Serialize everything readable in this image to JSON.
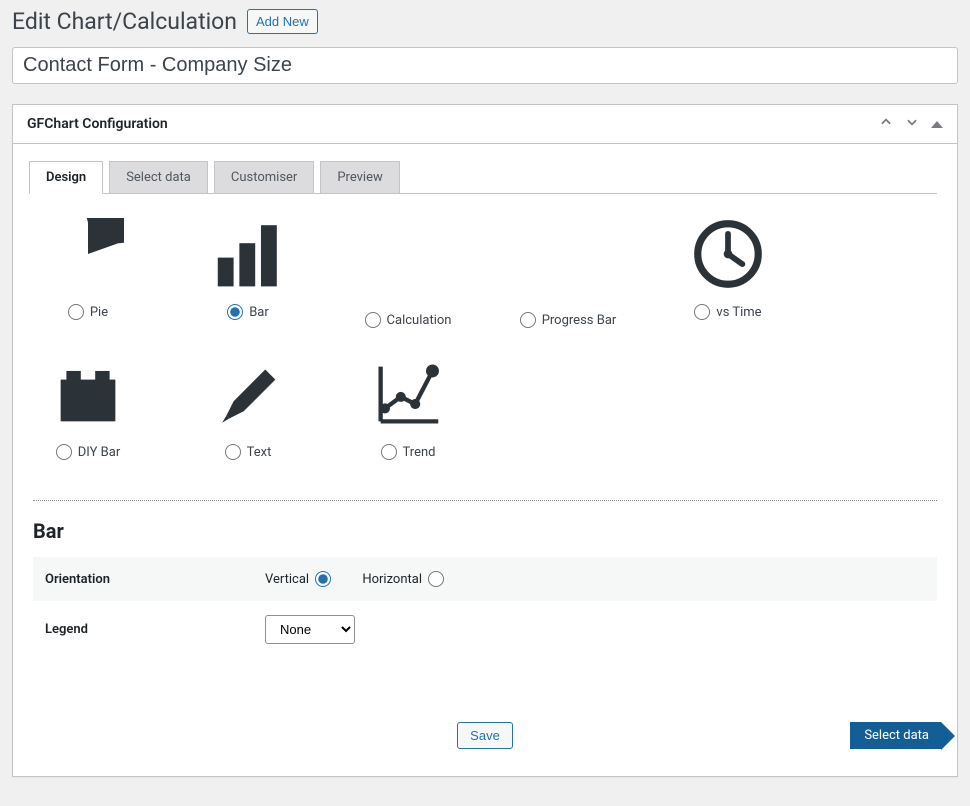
{
  "header": {
    "title": "Edit Chart/Calculation",
    "add_new": "Add New"
  },
  "chart_title": "Contact Form - Company Size",
  "panel": {
    "title": "GFChart Configuration"
  },
  "tabs": {
    "design": "Design",
    "select_data": "Select data",
    "customiser": "Customiser",
    "preview": "Preview"
  },
  "chart_types": {
    "pie": "Pie",
    "bar": "Bar",
    "calculation": "Calculation",
    "progress": "Progress Bar",
    "vstime": "vs Time",
    "diybar": "DIY Bar",
    "text": "Text",
    "trend": "Trend",
    "selected": "bar"
  },
  "section": {
    "heading": "Bar"
  },
  "settings": {
    "orientation_label": "Orientation",
    "orientation_vertical": "Vertical",
    "orientation_horizontal": "Horizontal",
    "orientation_value": "vertical",
    "legend_label": "Legend",
    "legend_value": "None"
  },
  "footer": {
    "save": "Save",
    "next": "Select data"
  }
}
